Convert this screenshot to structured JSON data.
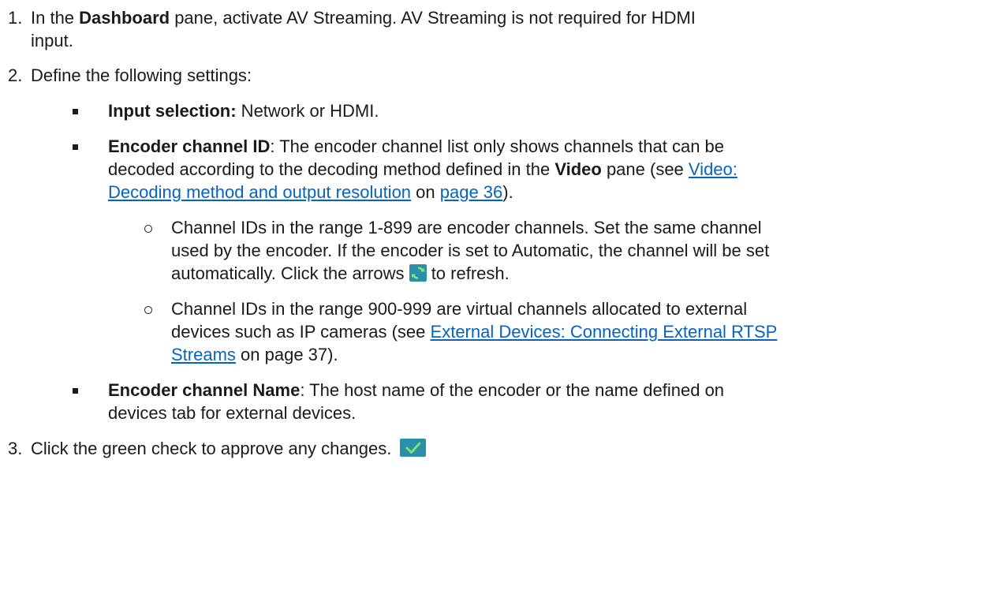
{
  "step1": {
    "num": "1.",
    "pre": "In the ",
    "bold": "Dashboard",
    "post": " pane, activate AV Streaming. AV Streaming is not required for HDMI",
    "cont": "input."
  },
  "step2": {
    "num": "2.",
    "text": "Define the following settings:",
    "input_selection": {
      "label": "Input selection:",
      "text": " Network or HDMI."
    },
    "encoder_id": {
      "label": "Encoder channel ID",
      "line1": ": The encoder channel list only shows channels that can be",
      "line2_pre": "decoded according to the decoding method defined in the ",
      "line2_bold": "Video",
      "line2_post": " pane (see ",
      "link1_part1": "Video:",
      "link1_part2": "Decoding method and output resolution",
      "line3_mid": " on ",
      "link2": "page 36",
      "line3_post": ")."
    },
    "sub1": {
      "line1": "Channel IDs in the range 1-899 are encoder channels.  Set the same channel",
      "line2": "used by the encoder. If the encoder is set to Automatic, the channel will be set",
      "line3_pre": "automatically. Click the arrows ",
      "line3_post": " to refresh."
    },
    "sub2": {
      "line1": "Channel IDs in the range 900-999 are virtual channels allocated to external",
      "line2_pre": "devices such as IP cameras (see ",
      "link_part1": "External Devices: Connecting External RTSP",
      "link_part2": "Streams",
      "line3_post": " on page 37)."
    },
    "encoder_name": {
      "label": "Encoder channel Name",
      "line1": ": The host name of the encoder or the name defined on",
      "line2": "devices tab for external devices."
    }
  },
  "step3": {
    "num": "3.",
    "text": "Click the green check to approve any changes."
  },
  "icons": {
    "refresh": "refresh-icon",
    "check": "check-icon"
  },
  "colors": {
    "link": "#0563c1",
    "refresh_bg": "#2a8fa8",
    "refresh_arrows": "#8be07a",
    "check_bg": "#2a8fa8",
    "check_mark": "#7ee06e"
  }
}
